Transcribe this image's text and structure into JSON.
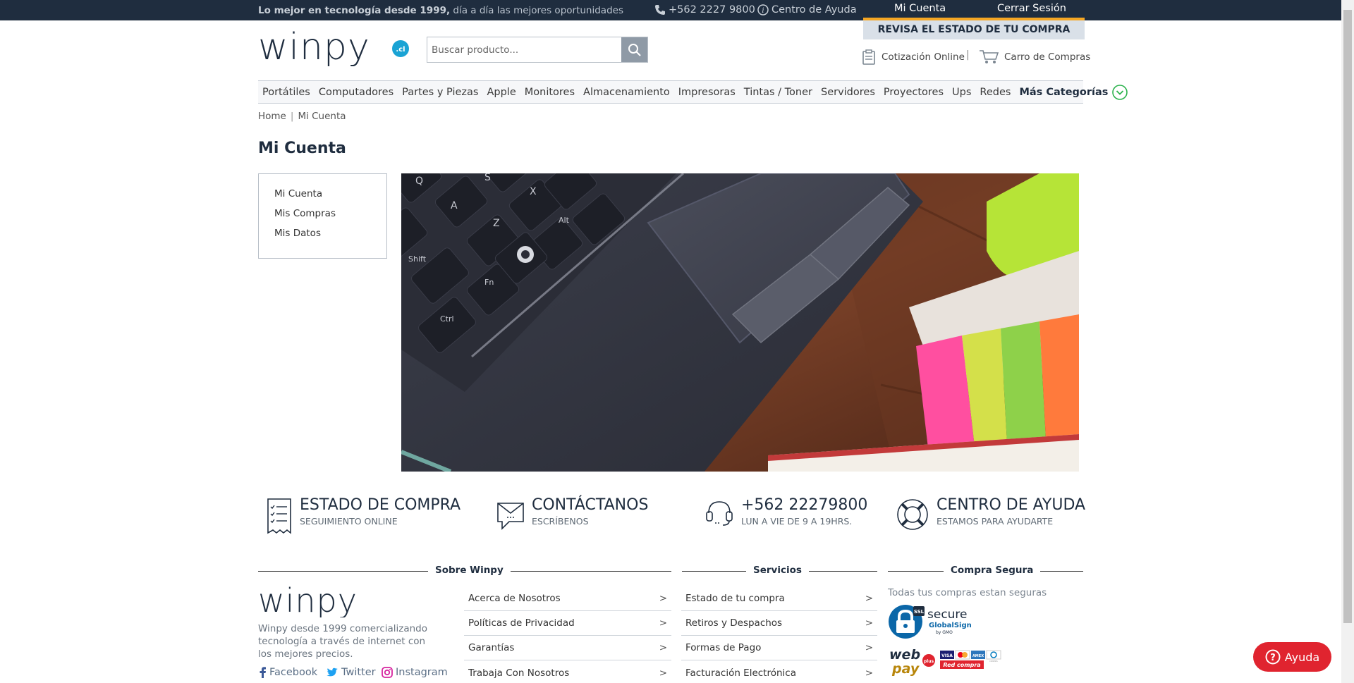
{
  "topbar": {
    "promo_bold": "Lo mejor en tecnología desde 1999,",
    "promo_rest": " día a día las mejores oportunidades",
    "phone": "+562 2227 9800",
    "help": "Centro de Ayuda",
    "account": "Mi Cuenta",
    "logout": "Cerrar Sesión",
    "order_status": "REVISA EL ESTADO DE TU COMPRA"
  },
  "header": {
    "logo_text": "winpy",
    "logo_badge": ".cl",
    "search_placeholder": "Buscar producto...",
    "quote_label": "Cotización Online",
    "separator": "|",
    "cart_label": "Carro de Compras"
  },
  "nav": {
    "items": [
      "Portátiles",
      "Computadores",
      "Partes y Piezas",
      "Apple",
      "Monitores",
      "Almacenamiento",
      "Impresoras",
      "Tintas / Toner",
      "Servidores",
      "Proyectores",
      "Ups",
      "Redes"
    ],
    "more": "Más Categorías"
  },
  "breadcrumb": {
    "home": "Home",
    "separator": "|",
    "current": "Mi Cuenta"
  },
  "page": {
    "title": "Mi Cuenta"
  },
  "sidebar": {
    "items": [
      "Mi Cuenta",
      "Mis Compras",
      "Mis Datos"
    ]
  },
  "hero": {
    "keys": [
      "Q",
      "S",
      "A",
      "Z",
      "X",
      "Alt",
      "Shift",
      "Fn",
      "Ctrl"
    ]
  },
  "features": [
    {
      "title": "ESTADO DE COMPRA",
      "subtitle": "SEGUIMIENTO ONLINE",
      "icon": "receipt-icon"
    },
    {
      "title": "CONTÁCTANOS",
      "subtitle": "ESCRÍBENOS",
      "icon": "envelope-icon"
    },
    {
      "title": "+562 22279800",
      "subtitle": "LUN A VIE DE 9 A 19HRS.",
      "icon": "headset-icon"
    },
    {
      "title": "CENTRO DE AYUDA",
      "subtitle": "ESTAMOS PARA AYUDARTE",
      "icon": "lifebuoy-icon"
    }
  ],
  "footer": {
    "about": {
      "heading": "Sobre Winpy",
      "logo_text": "winpy",
      "description": "Winpy desde 1999 comercializando tecnología a través de internet con los mejores precios.",
      "links": [
        "Acerca de Nosotros",
        "Políticas de Privacidad",
        "Garantías",
        "Trabaja Con Nosotros"
      ],
      "social": [
        "Facebook",
        "Twitter",
        "Instagram"
      ]
    },
    "services": {
      "heading": "Servicios",
      "links": [
        "Estado de tu compra",
        "Retiros y Despachos",
        "Formas de Pago",
        "Facturación Electrónica"
      ]
    },
    "secure": {
      "heading": "Compra Segura",
      "text": "Todas tus compras estan seguras",
      "ssl_badge": "SSL",
      "ssl_title": "secure",
      "ssl_brand": "GlobalSign",
      "ssl_sub": "by GMO",
      "webpay_top": "web",
      "webpay_bottom": "pay",
      "webpay_plus": "plus",
      "cards": [
        "VISA",
        "MC",
        "AMEX",
        "DINERS"
      ],
      "redcompra": "Red compra"
    },
    "link_arrow": ">"
  },
  "help_button": "Ayuda",
  "colors": {
    "topbar": "#1f2d3f",
    "accent_orange": "#f5a623",
    "help_red": "#e0242f",
    "logo_dark": "#1f2d3f",
    "logo_badge": "#1aa3d4"
  }
}
